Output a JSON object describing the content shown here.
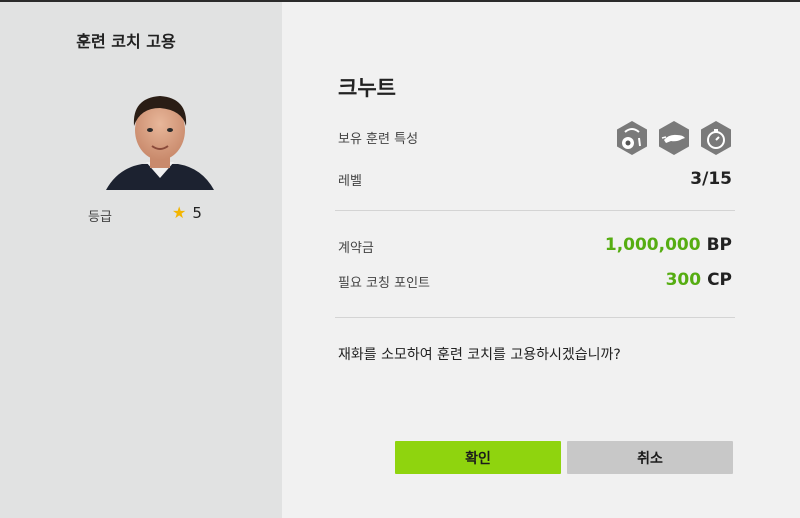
{
  "left_panel": {
    "title": "훈련 코치 고용",
    "grade_label": "등급",
    "grade_value": "5",
    "grade_icon": "star-icon"
  },
  "coach": {
    "name": "크누트",
    "skills_label": "보유 훈련 특성",
    "skill_icons": [
      "ball-dribble-icon",
      "cheetah-speed-icon",
      "stopwatch-icon"
    ],
    "level_label": "레벨",
    "level_value": "3/15"
  },
  "costs": {
    "contract_label": "계약금",
    "contract_amount": "1,000,000",
    "contract_unit": "BP",
    "coaching_label": "필요 코칭 포인트",
    "coaching_amount": "300",
    "coaching_unit": "CP"
  },
  "question": "재화를 소모하여 훈련 코치를 고용하시겠습니까?",
  "buttons": {
    "confirm": "확인",
    "cancel": "취소"
  },
  "colors": {
    "accent_green": "#8fd40e",
    "amount_green": "#56ad12",
    "star": "#f3b500"
  }
}
